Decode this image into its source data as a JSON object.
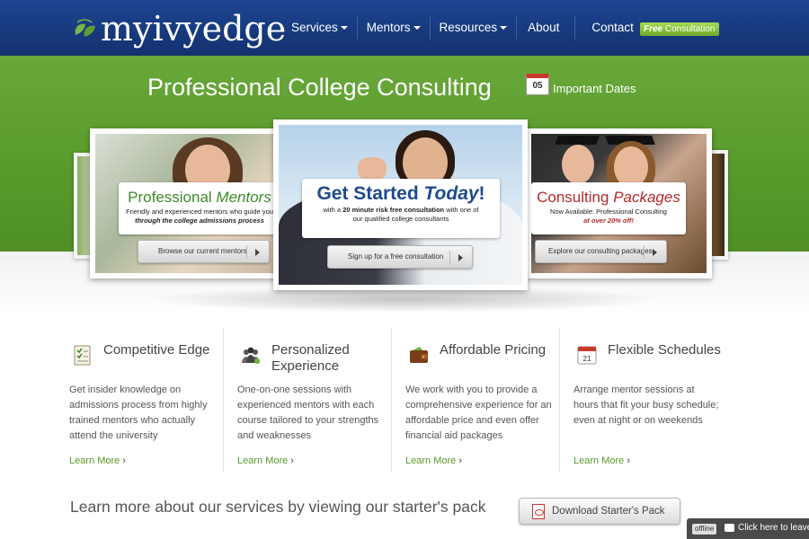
{
  "header": {
    "logo_text": "myivyedge",
    "nav": [
      {
        "label": "Services",
        "has_dropdown": true
      },
      {
        "label": "Mentors",
        "has_dropdown": true
      },
      {
        "label": "Resources",
        "has_dropdown": true
      },
      {
        "label": "About",
        "has_dropdown": false
      },
      {
        "label": "Contact",
        "has_dropdown": false
      }
    ],
    "free_consultation": {
      "em": "Free",
      "rest": " Consultation"
    }
  },
  "hero": {
    "title": "Professional College Consulting",
    "calendar_day": "05",
    "important_dates": "Important Dates"
  },
  "slides": {
    "left": {
      "title_a": "Professional ",
      "title_b": "Mentors",
      "sub_a": "Friendly and experienced mentors who guide you",
      "sub_b": "through the college admissions process",
      "button": "Browse our current mentors"
    },
    "center": {
      "title_a": "Get Started ",
      "title_b": "Today",
      "title_c": "!",
      "sub_a": "with a ",
      "sub_bold": "20 minute risk free consultation",
      "sub_c": " with one of",
      "sub_d": "our qualified college consultants",
      "button": "Sign up for a free consultation"
    },
    "right": {
      "title_a": "Consulting ",
      "title_b": "Packages",
      "sub_a": "Now Available: Professional Consulting",
      "sub_b": "at over 20% off!",
      "button": "Explore our consulting packages"
    }
  },
  "features": [
    {
      "title": "Competitive Edge",
      "text": "Get insider knowledge on admissions process from highly trained mentors who actually attend the university",
      "link": "Learn More",
      "icon": "checklist-icon"
    },
    {
      "title": "Personalized Experience",
      "text": "One-on-one sessions with experienced mentors with each course tailored to your strengths and weaknesses",
      "link": "Learn More",
      "icon": "people-icon"
    },
    {
      "title": "Affordable Pricing",
      "text": "We work with you to provide a comprehensive experience for an affordable price and even offer financial aid packages",
      "link": "Learn More",
      "icon": "wallet-icon"
    },
    {
      "title": "Flexible Schedules",
      "text": "Arrange mentor sessions at hours that fit your busy schedule; even at night or on weekends",
      "link": "Learn More",
      "icon": "calendar-icon"
    }
  ],
  "bottom": {
    "text": "Learn more about our services by viewing our starter's pack",
    "download_button": "Download Starter's Pack"
  },
  "chat": {
    "status": "offline",
    "label": "Click here to leave"
  },
  "colors": {
    "header_blue": "#1d4591",
    "hero_green": "#579a2b",
    "link_green": "#5a9a2a",
    "mentor_green": "#3f8a28",
    "center_blue": "#1f4a8c",
    "packages_red": "#b52a2a"
  }
}
